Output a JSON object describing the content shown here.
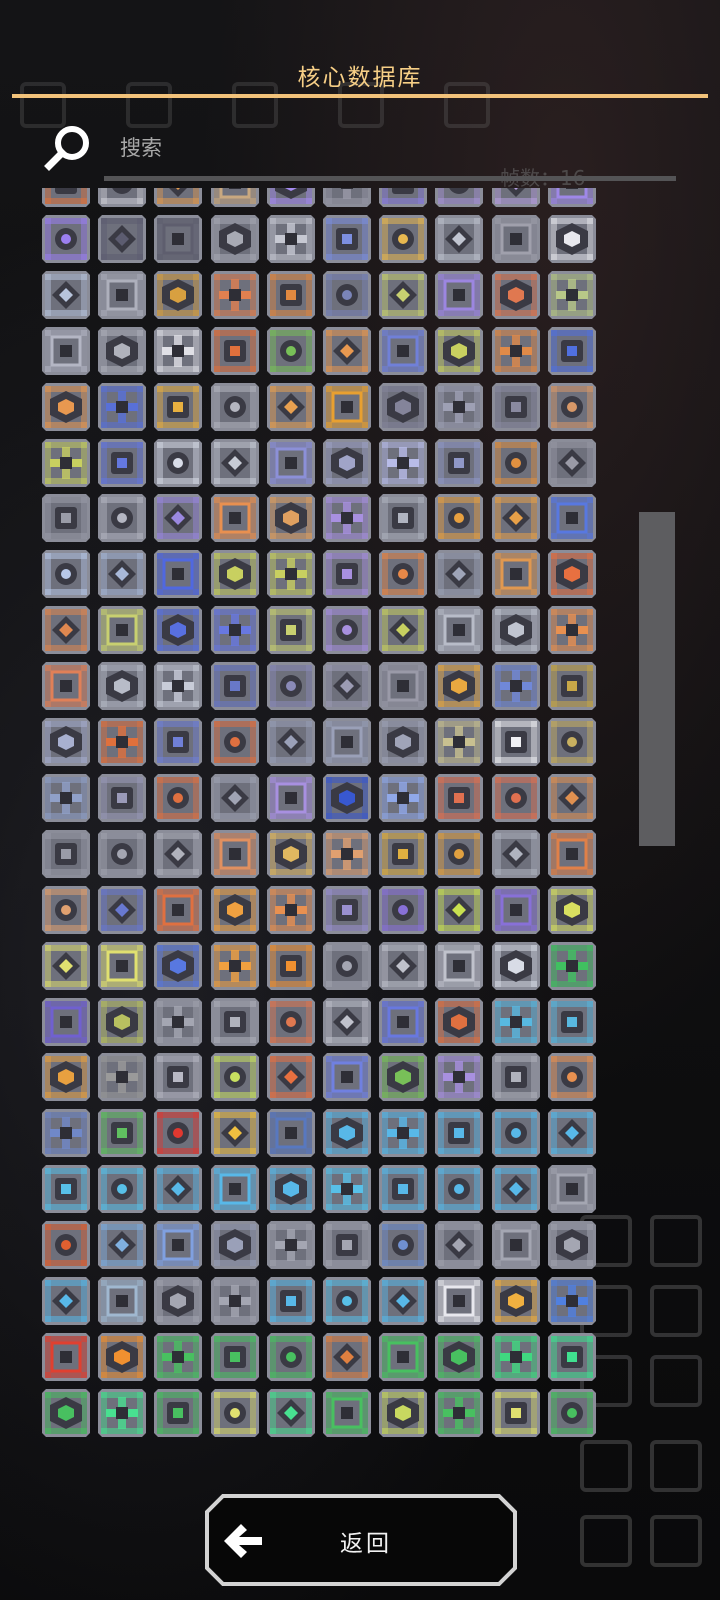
{
  "header": {
    "title": "核心数据库"
  },
  "search": {
    "placeholder": "搜索",
    "value": ""
  },
  "ghost_background": {
    "wave_count_label": "帧数：16"
  },
  "footer": {
    "back_label": "返回"
  },
  "grid": {
    "columns": 10,
    "tiles": [
      {
        "color": "#e0743c",
        "icon": "block-icon"
      },
      {
        "color": "#d0d0d8",
        "icon": "block-icon"
      },
      {
        "color": "#e09a50",
        "icon": "block-icon"
      },
      {
        "color": "#c8a880",
        "icon": "block-icon"
      },
      {
        "color": "#a58bf0",
        "icon": "block-icon"
      },
      {
        "color": "#9a9aa8",
        "icon": "block-icon"
      },
      {
        "color": "#8c7fe0",
        "icon": "block-icon"
      },
      {
        "color": "#a894d8",
        "icon": "block-icon"
      },
      {
        "color": "#b7a0e0",
        "icon": "block-icon"
      },
      {
        "color": "#9f88e8",
        "icon": "block-icon"
      },
      {
        "color": "#9b7ff0",
        "icon": "block-icon"
      },
      {
        "color": "#5c5c70",
        "icon": "block-icon"
      },
      {
        "color": "#5e5e6e",
        "icon": "block-icon"
      },
      {
        "color": "#a8aab4",
        "icon": "block-icon"
      },
      {
        "color": "#c6c8d2",
        "icon": "block-icon"
      },
      {
        "color": "#7d8fe0",
        "icon": "block-icon"
      },
      {
        "color": "#e8b850",
        "icon": "block-icon"
      },
      {
        "color": "#c0c4d0",
        "icon": "block-icon"
      },
      {
        "color": "#a0a0ac",
        "icon": "block-icon"
      },
      {
        "color": "#e8e8ee",
        "icon": "block-icon"
      },
      {
        "color": "#b8c4dc",
        "icon": "block-icon"
      },
      {
        "color": "#aeb0bc",
        "icon": "block-icon"
      },
      {
        "color": "#d8a040",
        "icon": "block-icon"
      },
      {
        "color": "#e08050",
        "icon": "block-icon"
      },
      {
        "color": "#e08840",
        "icon": "block-icon"
      },
      {
        "color": "#7a84b8",
        "icon": "block-icon"
      },
      {
        "color": "#c8d070",
        "icon": "block-icon"
      },
      {
        "color": "#9c86e0",
        "icon": "block-icon"
      },
      {
        "color": "#e07850",
        "icon": "block-icon"
      },
      {
        "color": "#b8c888",
        "icon": "block-icon"
      },
      {
        "color": "#b4b6c4",
        "icon": "block-icon"
      },
      {
        "color": "#b0b2bc",
        "icon": "block-icon"
      },
      {
        "color": "#e0e0e6",
        "icon": "block-icon"
      },
      {
        "color": "#e0703c",
        "icon": "block-icon"
      },
      {
        "color": "#78c058",
        "icon": "block-icon"
      },
      {
        "color": "#e89850",
        "icon": "block-icon"
      },
      {
        "color": "#7080d8",
        "icon": "block-icon"
      },
      {
        "color": "#c8d060",
        "icon": "block-icon"
      },
      {
        "color": "#e08a48",
        "icon": "block-icon"
      },
      {
        "color": "#5070e0",
        "icon": "block-icon"
      },
      {
        "color": "#e89850",
        "icon": "block-icon"
      },
      {
        "color": "#5870d8",
        "icon": "block-icon"
      },
      {
        "color": "#e8b040",
        "icon": "block-icon"
      },
      {
        "color": "#b4b6c0",
        "icon": "block-icon"
      },
      {
        "color": "#e8a050",
        "icon": "block-icon"
      },
      {
        "color": "#e8a030",
        "icon": "block-icon"
      },
      {
        "color": "#84849a",
        "icon": "block-icon"
      },
      {
        "color": "#9ea0b4",
        "icon": "block-icon"
      },
      {
        "color": "#8a8aa0",
        "icon": "block-icon"
      },
      {
        "color": "#d89868",
        "icon": "block-icon"
      },
      {
        "color": "#c8d060",
        "icon": "block-icon"
      },
      {
        "color": "#6478e0",
        "icon": "block-icon"
      },
      {
        "color": "#d8dce8",
        "icon": "block-icon"
      },
      {
        "color": "#c8ccd6",
        "icon": "block-icon"
      },
      {
        "color": "#8c90d8",
        "icon": "block-icon"
      },
      {
        "color": "#a0a4c8",
        "icon": "block-icon"
      },
      {
        "color": "#b8bce8",
        "icon": "block-icon"
      },
      {
        "color": "#9098c8",
        "icon": "block-icon"
      },
      {
        "color": "#e09040",
        "icon": "block-icon"
      },
      {
        "color": "#9a9aa6",
        "icon": "block-icon"
      },
      {
        "color": "#9a9ca8",
        "icon": "block-icon"
      },
      {
        "color": "#b4b6c2",
        "icon": "block-icon"
      },
      {
        "color": "#9a88e0",
        "icon": "block-icon"
      },
      {
        "color": "#e89050",
        "icon": "block-icon"
      },
      {
        "color": "#e0a060",
        "icon": "block-icon"
      },
      {
        "color": "#a890e0",
        "icon": "block-icon"
      },
      {
        "color": "#b0b4c0",
        "icon": "block-icon"
      },
      {
        "color": "#e8a040",
        "icon": "block-icon"
      },
      {
        "color": "#e8a048",
        "icon": "block-icon"
      },
      {
        "color": "#5878e0",
        "icon": "block-icon"
      },
      {
        "color": "#b8c8e8",
        "icon": "block-icon"
      },
      {
        "color": "#a8b8d8",
        "icon": "block-icon"
      },
      {
        "color": "#5068e0",
        "icon": "block-icon"
      },
      {
        "color": "#c8d060",
        "icon": "block-icon"
      },
      {
        "color": "#c8d060",
        "icon": "block-icon"
      },
      {
        "color": "#a890e0",
        "icon": "block-icon"
      },
      {
        "color": "#e88848",
        "icon": "block-icon"
      },
      {
        "color": "#9ea4b8",
        "icon": "block-icon"
      },
      {
        "color": "#e09850",
        "icon": "block-icon"
      },
      {
        "color": "#e87040",
        "icon": "block-icon"
      },
      {
        "color": "#e08850",
        "icon": "block-icon"
      },
      {
        "color": "#c8d070",
        "icon": "block-icon"
      },
      {
        "color": "#5870e0",
        "icon": "block-icon"
      },
      {
        "color": "#6878e0",
        "icon": "block-icon"
      },
      {
        "color": "#c8d070",
        "icon": "block-icon"
      },
      {
        "color": "#a890e0",
        "icon": "block-icon"
      },
      {
        "color": "#c8d060",
        "icon": "block-icon"
      },
      {
        "color": "#b8bcc8",
        "icon": "block-icon"
      },
      {
        "color": "#c0c4d0",
        "icon": "block-icon"
      },
      {
        "color": "#e89050",
        "icon": "block-icon"
      },
      {
        "color": "#e08058",
        "icon": "block-icon"
      },
      {
        "color": "#b8bcc8",
        "icon": "block-icon"
      },
      {
        "color": "#c8ccd8",
        "icon": "block-icon"
      },
      {
        "color": "#6878c8",
        "icon": "block-icon"
      },
      {
        "color": "#8a8ab8",
        "icon": "block-icon"
      },
      {
        "color": "#9c9cb4",
        "icon": "block-icon"
      },
      {
        "color": "#9a9aa8",
        "icon": "block-icon"
      },
      {
        "color": "#e8a840",
        "icon": "block-icon"
      },
      {
        "color": "#7088d8",
        "icon": "block-icon"
      },
      {
        "color": "#c8a848",
        "icon": "block-icon"
      },
      {
        "color": "#a8b0d0",
        "icon": "block-icon"
      },
      {
        "color": "#e0703c",
        "icon": "block-icon"
      },
      {
        "color": "#7080d8",
        "icon": "block-icon"
      },
      {
        "color": "#e07040",
        "icon": "block-icon"
      },
      {
        "color": "#9aa0b8",
        "icon": "block-icon"
      },
      {
        "color": "#9aa0b8",
        "icon": "block-icon"
      },
      {
        "color": "#a0a4b8",
        "icon": "block-icon"
      },
      {
        "color": "#c8c090",
        "icon": "block-icon"
      },
      {
        "color": "#f0f0f4",
        "icon": "block-icon"
      },
      {
        "color": "#c8b060",
        "icon": "block-icon"
      },
      {
        "color": "#90a0c8",
        "icon": "block-icon"
      },
      {
        "color": "#9a9ab8",
        "icon": "block-icon"
      },
      {
        "color": "#e07040",
        "icon": "block-icon"
      },
      {
        "color": "#a0a4b4",
        "icon": "block-icon"
      },
      {
        "color": "#a890e0",
        "icon": "block-icon"
      },
      {
        "color": "#3858d0",
        "icon": "block-icon"
      },
      {
        "color": "#90a8e8",
        "icon": "block-icon"
      },
      {
        "color": "#e07050",
        "icon": "block-icon"
      },
      {
        "color": "#e07050",
        "icon": "block-icon"
      },
      {
        "color": "#e09050",
        "icon": "block-icon"
      },
      {
        "color": "#9a9ca8",
        "icon": "block-icon"
      },
      {
        "color": "#a4a6b2",
        "icon": "block-icon"
      },
      {
        "color": "#b0b2bc",
        "icon": "block-icon"
      },
      {
        "color": "#e09060",
        "icon": "block-icon"
      },
      {
        "color": "#e0b860",
        "icon": "block-icon"
      },
      {
        "color": "#e0a070",
        "icon": "block-icon"
      },
      {
        "color": "#e0b040",
        "icon": "block-icon"
      },
      {
        "color": "#e0a040",
        "icon": "block-icon"
      },
      {
        "color": "#b0b4c0",
        "icon": "block-icon"
      },
      {
        "color": "#e08048",
        "icon": "block-icon"
      },
      {
        "color": "#e0a070",
        "icon": "block-icon"
      },
      {
        "color": "#6878d0",
        "icon": "block-icon"
      },
      {
        "color": "#e07040",
        "icon": "block-icon"
      },
      {
        "color": "#f0a040",
        "icon": "block-icon"
      },
      {
        "color": "#e89050",
        "icon": "block-icon"
      },
      {
        "color": "#9a90d0",
        "icon": "block-icon"
      },
      {
        "color": "#8870d8",
        "icon": "block-icon"
      },
      {
        "color": "#c8e050",
        "icon": "block-icon"
      },
      {
        "color": "#8870d8",
        "icon": "block-icon"
      },
      {
        "color": "#d8e060",
        "icon": "block-icon"
      },
      {
        "color": "#e0e070",
        "icon": "block-icon"
      },
      {
        "color": "#e0e070",
        "icon": "block-icon"
      },
      {
        "color": "#5878e0",
        "icon": "block-icon"
      },
      {
        "color": "#f0a040",
        "icon": "block-icon"
      },
      {
        "color": "#f09030",
        "icon": "block-icon"
      },
      {
        "color": "#a4a6b2",
        "icon": "block-icon"
      },
      {
        "color": "#c0c2cc",
        "icon": "block-icon"
      },
      {
        "color": "#c0c2cc",
        "icon": "block-icon"
      },
      {
        "color": "#d8dce6",
        "icon": "block-icon"
      },
      {
        "color": "#40c060",
        "icon": "block-icon"
      },
      {
        "color": "#7060d0",
        "icon": "block-icon"
      },
      {
        "color": "#b8c060",
        "icon": "block-icon"
      },
      {
        "color": "#a4a6b2",
        "icon": "block-icon"
      },
      {
        "color": "#b0b2bc",
        "icon": "block-icon"
      },
      {
        "color": "#e07850",
        "icon": "block-icon"
      },
      {
        "color": "#c0c2cc",
        "icon": "block-icon"
      },
      {
        "color": "#6878e0",
        "icon": "block-icon"
      },
      {
        "color": "#e07040",
        "icon": "block-icon"
      },
      {
        "color": "#58b8e0",
        "icon": "block-icon"
      },
      {
        "color": "#58b8e0",
        "icon": "block-icon"
      },
      {
        "color": "#e8a040",
        "icon": "block-icon"
      },
      {
        "color": "#9a9a9a",
        "icon": "block-icon"
      },
      {
        "color": "#b8b8c4",
        "icon": "block-icon"
      },
      {
        "color": "#c8e060",
        "icon": "block-icon"
      },
      {
        "color": "#e87040",
        "icon": "block-icon"
      },
      {
        "color": "#7080e0",
        "icon": "block-icon"
      },
      {
        "color": "#78c058",
        "icon": "block-icon"
      },
      {
        "color": "#a890e0",
        "icon": "block-icon"
      },
      {
        "color": "#b0b2bc",
        "icon": "block-icon"
      },
      {
        "color": "#e89050",
        "icon": "block-icon"
      },
      {
        "color": "#7088c8",
        "icon": "block-icon"
      },
      {
        "color": "#60c060",
        "icon": "block-icon"
      },
      {
        "color": "#e03830",
        "icon": "block-icon"
      },
      {
        "color": "#f0c040",
        "icon": "block-icon"
      },
      {
        "color": "#5878c0",
        "icon": "block-icon"
      },
      {
        "color": "#58b8e8",
        "icon": "block-icon"
      },
      {
        "color": "#58b8e8",
        "icon": "block-icon"
      },
      {
        "color": "#58b8e8",
        "icon": "block-icon"
      },
      {
        "color": "#58b8e8",
        "icon": "block-icon"
      },
      {
        "color": "#58b8e8",
        "icon": "block-icon"
      },
      {
        "color": "#58c0e8",
        "icon": "block-icon"
      },
      {
        "color": "#58c0e8",
        "icon": "block-icon"
      },
      {
        "color": "#58b8e8",
        "icon": "block-icon"
      },
      {
        "color": "#58b8e8",
        "icon": "block-icon"
      },
      {
        "color": "#58b8e8",
        "icon": "block-icon"
      },
      {
        "color": "#58c0e8",
        "icon": "block-icon"
      },
      {
        "color": "#58b8e8",
        "icon": "block-icon"
      },
      {
        "color": "#58b8e8",
        "icon": "block-icon"
      },
      {
        "color": "#58b8e8",
        "icon": "block-icon"
      },
      {
        "color": "#a4a6b2",
        "icon": "block-icon"
      },
      {
        "color": "#e06030",
        "icon": "block-icon"
      },
      {
        "color": "#80b0e0",
        "icon": "block-icon"
      },
      {
        "color": "#80a0e0",
        "icon": "block-icon"
      },
      {
        "color": "#9aa0b8",
        "icon": "block-icon"
      },
      {
        "color": "#a4a6b2",
        "icon": "block-icon"
      },
      {
        "color": "#a4a6b2",
        "icon": "block-icon"
      },
      {
        "color": "#7090d0",
        "icon": "block-icon"
      },
      {
        "color": "#a4a6b2",
        "icon": "block-icon"
      },
      {
        "color": "#a4a6b2",
        "icon": "block-icon"
      },
      {
        "color": "#a4a6b2",
        "icon": "block-icon"
      },
      {
        "color": "#58b8e8",
        "icon": "block-icon"
      },
      {
        "color": "#a0b8d0",
        "icon": "block-icon"
      },
      {
        "color": "#a4a6b2",
        "icon": "block-icon"
      },
      {
        "color": "#a4a6b2",
        "icon": "block-icon"
      },
      {
        "color": "#58b8e8",
        "icon": "block-icon"
      },
      {
        "color": "#58c0e8",
        "icon": "block-icon"
      },
      {
        "color": "#58b8e8",
        "icon": "block-icon"
      },
      {
        "color": "#e8e8ee",
        "icon": "block-icon"
      },
      {
        "color": "#f0b040",
        "icon": "block-icon"
      },
      {
        "color": "#5080e0",
        "icon": "block-icon"
      },
      {
        "color": "#e04030",
        "icon": "block-icon"
      },
      {
        "color": "#f09030",
        "icon": "block-icon"
      },
      {
        "color": "#48c060",
        "icon": "block-icon"
      },
      {
        "color": "#48c060",
        "icon": "block-icon"
      },
      {
        "color": "#48c060",
        "icon": "block-icon"
      },
      {
        "color": "#e08040",
        "icon": "block-icon"
      },
      {
        "color": "#48c060",
        "icon": "block-icon"
      },
      {
        "color": "#48c060",
        "icon": "block-icon"
      },
      {
        "color": "#40d880",
        "icon": "block-icon"
      },
      {
        "color": "#40e090",
        "icon": "block-icon"
      },
      {
        "color": "#48c060",
        "icon": "block-icon"
      },
      {
        "color": "#48e090",
        "icon": "block-icon"
      },
      {
        "color": "#48c060",
        "icon": "block-icon"
      },
      {
        "color": "#e0e070",
        "icon": "block-icon"
      },
      {
        "color": "#48e090",
        "icon": "block-icon"
      },
      {
        "color": "#48c060",
        "icon": "block-icon"
      },
      {
        "color": "#c8d860",
        "icon": "block-icon"
      },
      {
        "color": "#48c060",
        "icon": "block-icon"
      },
      {
        "color": "#e0e070",
        "icon": "block-icon"
      },
      {
        "color": "#48c060",
        "icon": "block-icon"
      }
    ]
  }
}
